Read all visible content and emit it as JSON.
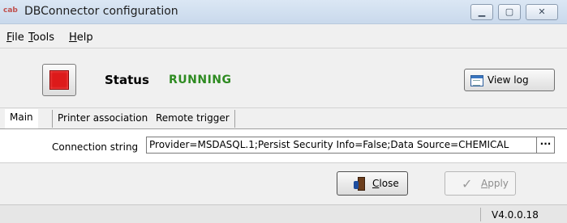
{
  "window": {
    "logo": "cab",
    "title": "DBConnector configuration",
    "minimize": "▁",
    "maximize": "▢",
    "close": "✕"
  },
  "menu": {
    "file_first": "F",
    "file_rest": "ile",
    "tools_first": "T",
    "tools_rest": "ools",
    "help_first": "H",
    "help_rest": "elp"
  },
  "status": {
    "label": "Status",
    "value": "RUNNING",
    "value_color": "#2e8b21",
    "stop_icon": "stop-icon",
    "view_log_label": "View log",
    "view_log_icon": "log-window-icon"
  },
  "tabs": [
    {
      "label": "Main",
      "active": true
    },
    {
      "label": "Printer association",
      "active": false
    },
    {
      "label": "Remote trigger",
      "active": false
    }
  ],
  "main_tab": {
    "connection_label": "Connection string",
    "connection_value": "Provider=MSDASQL.1;Persist Security Info=False;Data Source=CHEMICAL",
    "browse_label": "···"
  },
  "buttons": {
    "close_first": "C",
    "close_rest": "lose",
    "close_icon": "exit-door-icon",
    "apply_first": "A",
    "apply_rest": "pply",
    "apply_icon": "checkmark-icon",
    "apply_enabled": false
  },
  "statusbar": {
    "version": "V4.0.0.18"
  }
}
